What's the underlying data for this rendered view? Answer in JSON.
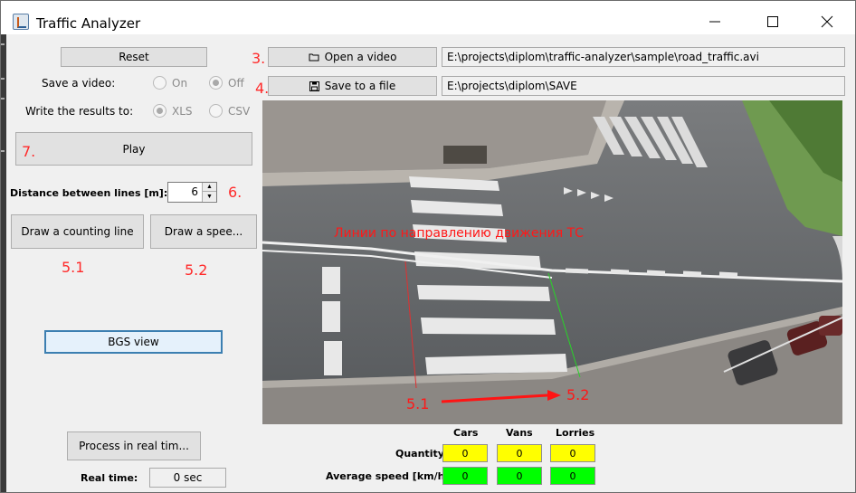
{
  "window": {
    "title": "Traffic Analyzer"
  },
  "title_buttons": {
    "minimize": "minimize-icon",
    "maximize": "maximize-icon",
    "close": "close-icon"
  },
  "left": {
    "reset_label": "Reset",
    "save_video_label": "Save a video:",
    "save_video_options": [
      {
        "label": "On",
        "checked": false
      },
      {
        "label": "Off",
        "checked": true
      }
    ],
    "write_results_label": "Write the results to:",
    "write_results_options": [
      {
        "label": "XLS",
        "checked": true
      },
      {
        "label": "CSV",
        "checked": false
      }
    ],
    "play_label": "Play",
    "distance_label": "Distance between lines [m]:",
    "distance_value": "6",
    "draw_counting_label": "Draw a counting line",
    "draw_speed_label": "Draw a spee...",
    "bgs_label": "BGS view",
    "process_label": "Process in real tim...",
    "realtime_label": "Real time:",
    "realtime_value": "0 sec"
  },
  "top": {
    "open_video_label": "Open a video",
    "open_video_icon": "folder-icon",
    "video_path": "E:\\projects\\diplom\\traffic-analyzer\\sample\\road_traffic.avi",
    "save_file_label": "Save to a file",
    "save_file_icon": "floppy-disk-icon",
    "save_path": "E:\\projects\\diplom\\SAVE"
  },
  "annotations": {
    "a3": "3.",
    "a4": "4.",
    "a7": "7.",
    "a6": "6.",
    "a51": "5.1",
    "a52": "5.2",
    "video_caption": "Линии по направлению движения ТС",
    "video_51": "5.1",
    "video_52": "5.2"
  },
  "stats": {
    "columns": [
      "Cars",
      "Vans",
      "Lorries"
    ],
    "quantity_label": "Quantity",
    "speed_label": "Average speed [km/h]",
    "quantity": [
      "0",
      "0",
      "0"
    ],
    "speed": [
      "0",
      "0",
      "0"
    ]
  },
  "colors": {
    "annotation_red": "#ff2a2a",
    "quantity_bg": "#ffff00",
    "speed_bg": "#00ff00"
  }
}
